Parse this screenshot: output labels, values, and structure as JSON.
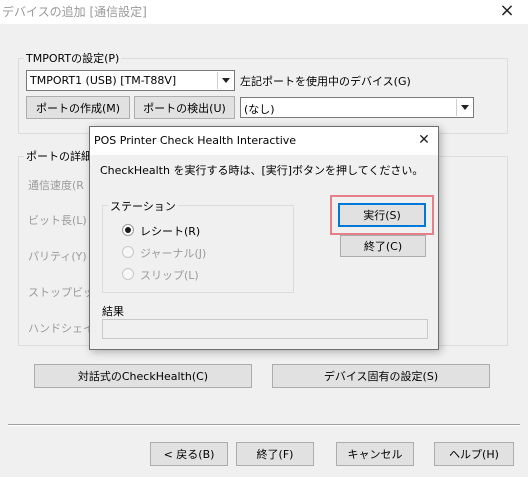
{
  "window": {
    "title": "デバイスの追加 [通信設定]",
    "close_glyph": "×"
  },
  "tmport": {
    "legend": "TMPORTの設定(P)",
    "port_value": "TMPORT1 (USB) [TM-T88V]",
    "port_label": "左記ポートを使用中のデバイス(G)",
    "create_button": "ポートの作成(M)",
    "detect_button": "ポートの検出(U)",
    "device_value": "(なし)"
  },
  "port_details": {
    "legend": "ポートの詳細",
    "labels": [
      "通信速度(R",
      "ビット長(L)",
      "パリティ(Y)",
      "ストップビット(",
      "ハンドシェイク"
    ]
  },
  "main_buttons": {
    "interactive_check": "対話式のCheckHealth(C)",
    "device_settings": "デバイス固有の設定(S)",
    "back": "< 戻る(B)",
    "finish": "終了(F)",
    "cancel": "キャンセル",
    "help": "ヘルプ(H)"
  },
  "dialog": {
    "title": "POS Printer Check Health Interactive",
    "close_glyph": "✕",
    "instruction": "CheckHealth を実行する時は、[実行]ボタンを押してください。",
    "station_legend": "ステーション",
    "stations": [
      {
        "label": "レシート(R)",
        "selected": true,
        "enabled": true
      },
      {
        "label": "ジャーナル(J)",
        "selected": false,
        "enabled": false
      },
      {
        "label": "スリップ(L)",
        "selected": false,
        "enabled": false
      }
    ],
    "execute_button": "実行(S)",
    "close_button": "終了(C)",
    "result_label": "結果",
    "result_value": ""
  },
  "colors": {
    "highlight_frame": "#e68088",
    "default_button_border": "#0078d7",
    "disabled_text": "#9b9b9b"
  }
}
